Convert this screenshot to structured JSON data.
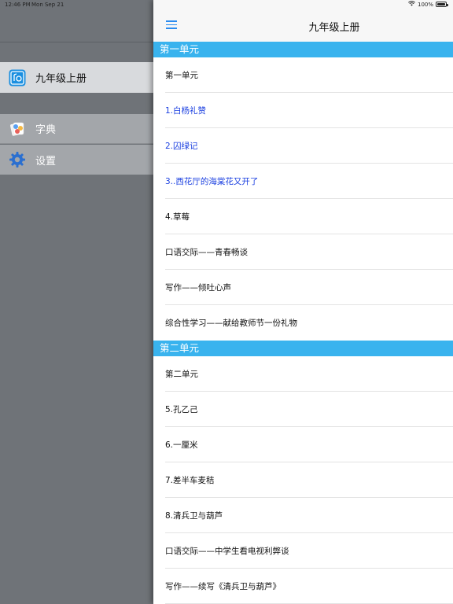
{
  "status_bar": {
    "time": "12:46 PM",
    "date": "Mon Sep 21",
    "battery": "100%",
    "icons": [
      "wifi-icon",
      "battery-icon"
    ]
  },
  "sidebar": {
    "items": [
      {
        "label": "九年级上册",
        "icon": "book-app-icon",
        "selected": true
      },
      {
        "label": "字典",
        "icon": "dictionary-icon"
      },
      {
        "label": "设置",
        "icon": "gear-icon"
      }
    ]
  },
  "header": {
    "title": "九年级上册",
    "menu_icon": "hamburger-menu-icon"
  },
  "sections": [
    {
      "title": "第一单元",
      "items": [
        {
          "label": "第一单元",
          "color": "#111111"
        },
        {
          "label": "1.白杨礼赞",
          "color": "#1a3fe0"
        },
        {
          "label": "2.囚绿记",
          "color": "#1a3fe0"
        },
        {
          "label": "3..西花厅的海棠花又开了",
          "color": "#1a3fe0"
        },
        {
          "label": "4.草莓",
          "color": "#111111"
        },
        {
          "label": "口语交际——青春畅谈",
          "color": "#111111"
        },
        {
          "label": "写作——倾吐心声",
          "color": "#111111"
        },
        {
          "label": "综合性学习——献给教师节一份礼物",
          "color": "#111111"
        }
      ]
    },
    {
      "title": "第二单元",
      "items": [
        {
          "label": "第二单元",
          "color": "#111111"
        },
        {
          "label": "5.孔乙己",
          "color": "#111111"
        },
        {
          "label": "6.一厘米",
          "color": "#111111"
        },
        {
          "label": "7.差半车麦秸",
          "color": "#111111"
        },
        {
          "label": "8.清兵卫与葫芦",
          "color": "#111111"
        },
        {
          "label": "口语交际——中学生看电视利弊谈",
          "color": "#111111"
        },
        {
          "label": "写作——续写《清兵卫与葫芦》",
          "color": "#111111"
        }
      ]
    }
  ],
  "colors": {
    "section_header_bg": "#39b3ee",
    "link_blue": "#1a3fe0",
    "sidebar_selected_bg": "#d8dadd",
    "sidebar_item_bg": "#a3a6aa"
  }
}
